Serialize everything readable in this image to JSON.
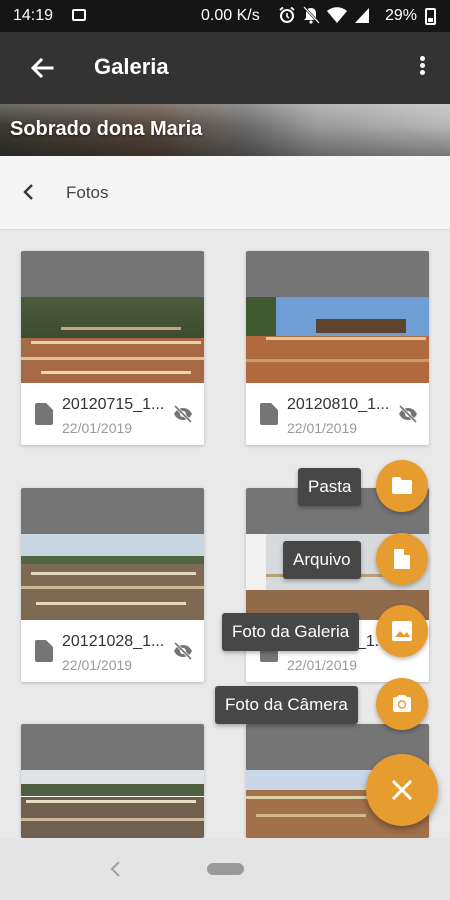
{
  "status_bar": {
    "time": "14:19",
    "network_speed": "0.00 K/s",
    "battery": "29%",
    "icons": [
      "image-icon",
      "alarm-icon",
      "mute-icon",
      "wifi-icon",
      "signal-icon",
      "battery-icon"
    ]
  },
  "toolbar": {
    "title": "Galeria",
    "icons": [
      "arrow-back-icon",
      "more-vert-icon"
    ]
  },
  "banner": {
    "title": "Sobrado dona Maria"
  },
  "breadcrumb": {
    "label": "Fotos"
  },
  "gallery": {
    "cards": [
      {
        "name": "20120715_1...",
        "date": "22/01/2019"
      },
      {
        "name": "20120810_1...",
        "date": "22/01/2019"
      },
      {
        "name": "20121028_1...",
        "date": "22/01/2019"
      },
      {
        "name": "20121108_1...",
        "date": "22/01/2019"
      },
      {
        "name": "",
        "date": ""
      },
      {
        "name": "",
        "date": ""
      }
    ]
  },
  "fab_menu": {
    "items": [
      {
        "label": "Pasta",
        "icon": "folder-icon"
      },
      {
        "label": "Arquivo",
        "icon": "file-icon"
      },
      {
        "label": "Foto da Galeria",
        "icon": "image-icon"
      },
      {
        "label": "Foto da Câmera",
        "icon": "camera-icon"
      }
    ],
    "close_icon": "close-icon"
  },
  "colors": {
    "accent": "#e79c2f",
    "toolbar": "#333333",
    "status_bar": "#151515",
    "card_header": "#757575"
  }
}
